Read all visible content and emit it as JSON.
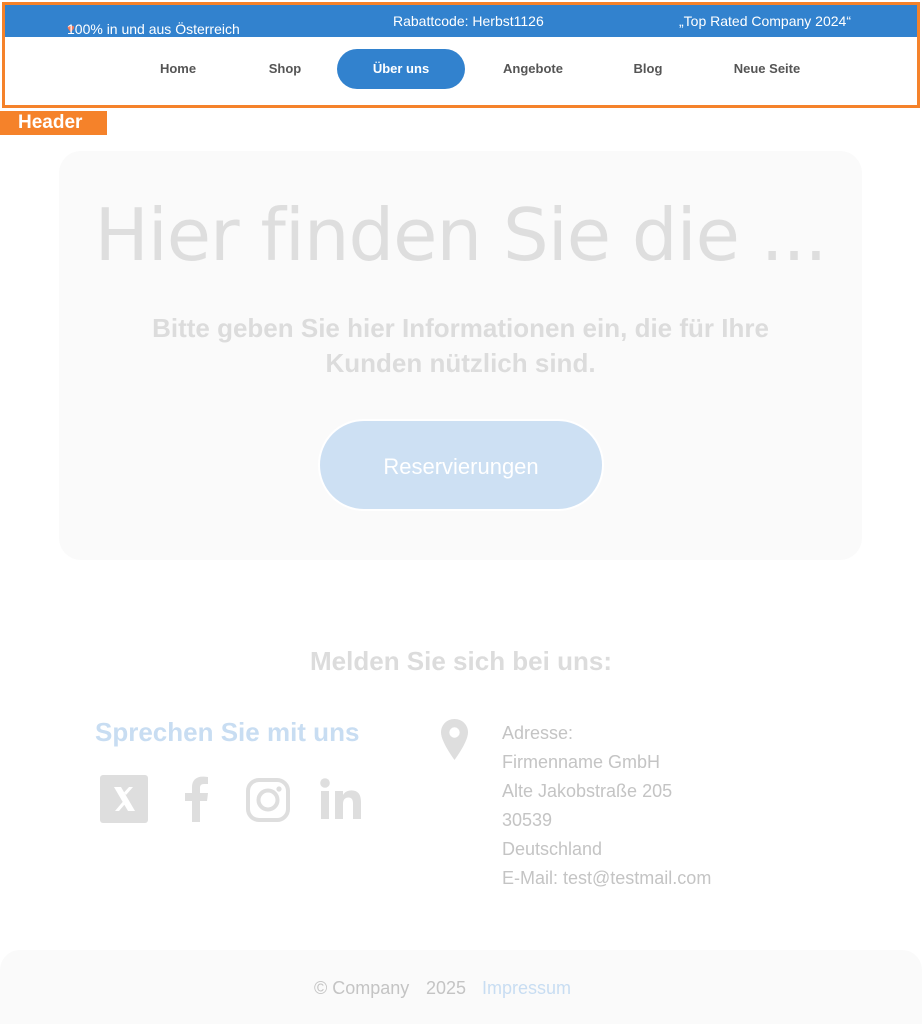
{
  "topbar": {
    "left_text": "100% in und aus Österreich",
    "middle_text": "Rabattcode: Herbst1126",
    "right_text": "„Top Rated Company 2024“"
  },
  "nav": {
    "items": [
      {
        "label": "Home"
      },
      {
        "label": "Shop"
      },
      {
        "label": "Über uns",
        "active": true
      },
      {
        "label": "Angebote"
      },
      {
        "label": "Blog"
      },
      {
        "label": "Neue Seite"
      }
    ]
  },
  "header_tag": "Header",
  "hero": {
    "title": "Hier finden Sie die ...",
    "subtitle": "Bitte geben Sie hier Informationen ein, die für Ihre Kunden nützlich sind.",
    "button_label": "Reservierungen"
  },
  "contact": {
    "heading": "Melden Sie sich bei uns:",
    "talk_heading": "Sprechen Sie mit uns",
    "social_icons": [
      "x-icon",
      "facebook-icon",
      "instagram-icon",
      "linkedin-icon"
    ],
    "address_lines": [
      "Adresse:",
      "Firmenname GmbH",
      "Alte Jakobstraße 205",
      "30539",
      "Deutschland",
      "E-Mail: test@testmail.com"
    ]
  },
  "footer": {
    "copyright": "© Company",
    "year": "2025",
    "impressum": "Impressum"
  },
  "colors": {
    "accent": "#3282ce",
    "highlight": "#f5822a"
  }
}
